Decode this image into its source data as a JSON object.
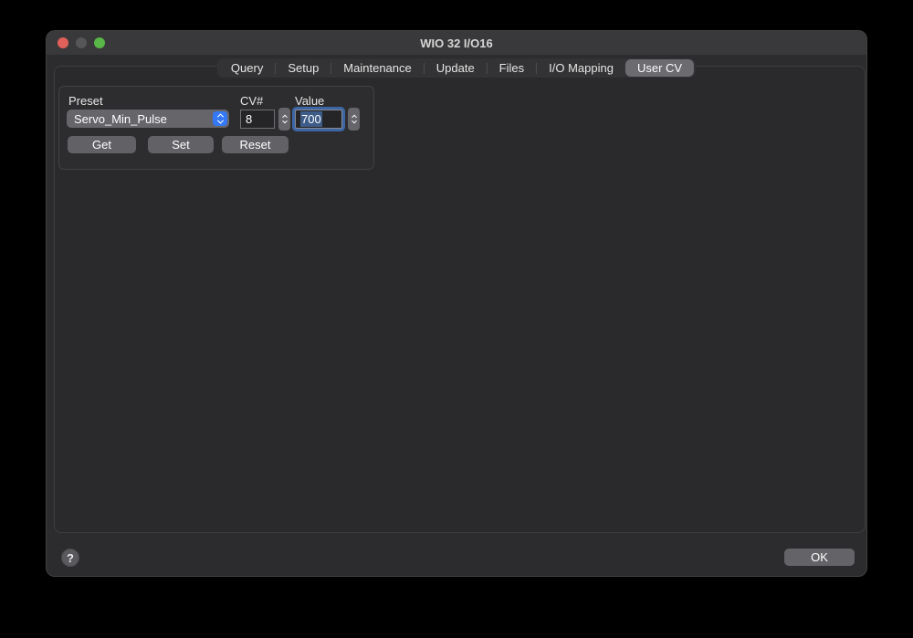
{
  "window": {
    "title": "WIO 32 I/O16"
  },
  "tabs": [
    {
      "label": "Query",
      "selected": false
    },
    {
      "label": "Setup",
      "selected": false
    },
    {
      "label": "Maintenance",
      "selected": false
    },
    {
      "label": "Update",
      "selected": false
    },
    {
      "label": "Files",
      "selected": false
    },
    {
      "label": "I/O Mapping",
      "selected": false
    },
    {
      "label": "User CV",
      "selected": true
    }
  ],
  "user_cv_panel": {
    "preset": {
      "label": "Preset",
      "selected_option": "Servo_Min_Pulse"
    },
    "cv_number": {
      "label": "CV#",
      "value": "8"
    },
    "value": {
      "label": "Value",
      "value": "700",
      "focused": true,
      "text_selected": true
    },
    "buttons": {
      "get": "Get",
      "set": "Set",
      "reset": "Reset"
    }
  },
  "footer": {
    "help": "?",
    "ok": "OK"
  },
  "colors": {
    "accent_blue": "#3478f6",
    "focus_ring": "#3c66a5",
    "text_selection": "#3d5c88",
    "traffic_red": "#e0605a",
    "traffic_gray": "#565658",
    "traffic_green": "#58b747",
    "window_bg": "#2c2c2e",
    "titlebar_bg": "#39393b",
    "control_gray": "#65656a"
  }
}
